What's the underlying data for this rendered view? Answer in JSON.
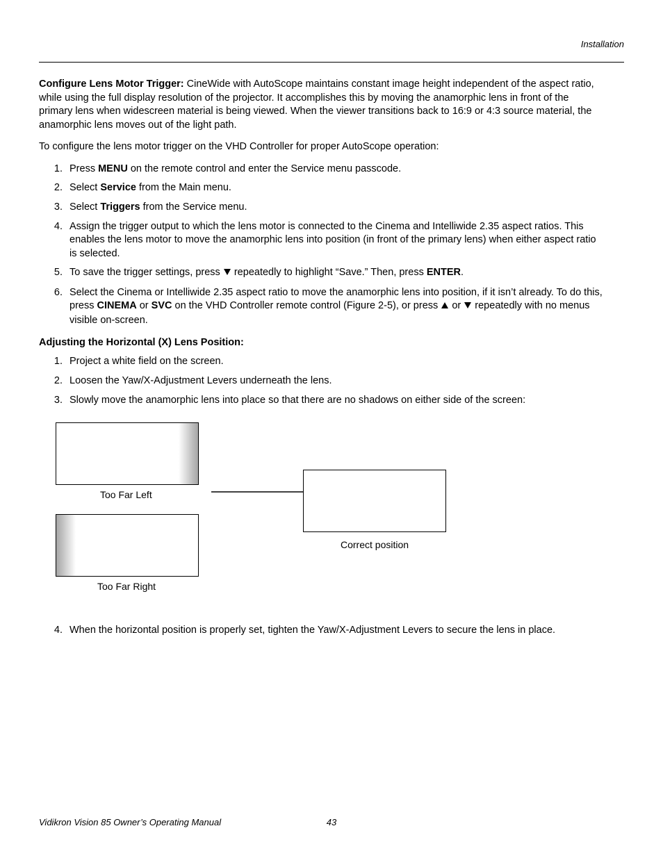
{
  "header": {
    "section": "Installation"
  },
  "intro": {
    "lead_bold": "Configure Lens Motor Trigger: ",
    "lead_text": "CineWide with AutoScope maintains constant image height independent of the aspect ratio, while using the full display resolution of the projector. It accomplishes this by moving the anamorphic lens in front of the primary lens when widescreen material is being viewed. When the viewer transitions back to 16:9 or 4:3 source material, the anamorphic lens moves out of the light path.",
    "para2": "To configure the lens motor trigger on the VHD Controller for proper AutoScope operation:"
  },
  "list1": {
    "i1_a": "Press ",
    "i1_b": "MENU",
    "i1_c": " on the remote control and enter the Service menu passcode.",
    "i2_a": "Select ",
    "i2_b": "Service",
    "i2_c": " from the Main menu.",
    "i3_a": "Select ",
    "i3_b": "Triggers",
    "i3_c": " from the Service menu.",
    "i4": "Assign the trigger output to which the lens motor is connected to the Cinema and Intelliwide 2.35 aspect ratios. This enables the lens motor to move the anamorphic lens into position (in front of the primary lens) when either aspect ratio is selected.",
    "i5_a": "To save the trigger settings, press ",
    "i5_b": " repeatedly to highlight “Save.” Then, press ",
    "i5_c": "ENTER",
    "i5_d": ".",
    "i6_a": "Select the Cinema or Intelliwide 2.35 aspect ratio to move the anamorphic lens into position, if it isn’t already. To do this, press ",
    "i6_b": "CINEMA",
    "i6_c": " or ",
    "i6_d": "SVC",
    "i6_e": " on the VHD Controller remote control (Figure 2-5), or press ",
    "i6_f": " or ",
    "i6_g": " repeatedly with no menus visible on-screen."
  },
  "subhead": "Adjusting the Horizontal (X) Lens Position:",
  "list2": {
    "i1": "Project a white field on the screen.",
    "i2": "Loosen the Yaw/X-Adjustment Levers underneath the lens.",
    "i3": "Slowly move the anamorphic lens into place so that there are no shadows on either side of the screen:",
    "i4": "When the horizontal position is properly set, tighten the Yaw/X-Adjustment Levers to secure the lens in place."
  },
  "diagram": {
    "too_left": "Too Far Left",
    "too_right": "Too Far Right",
    "correct": "Correct position"
  },
  "footer": {
    "title": "Vidikron Vision 85 Owner’s Operating Manual",
    "page": "43"
  }
}
